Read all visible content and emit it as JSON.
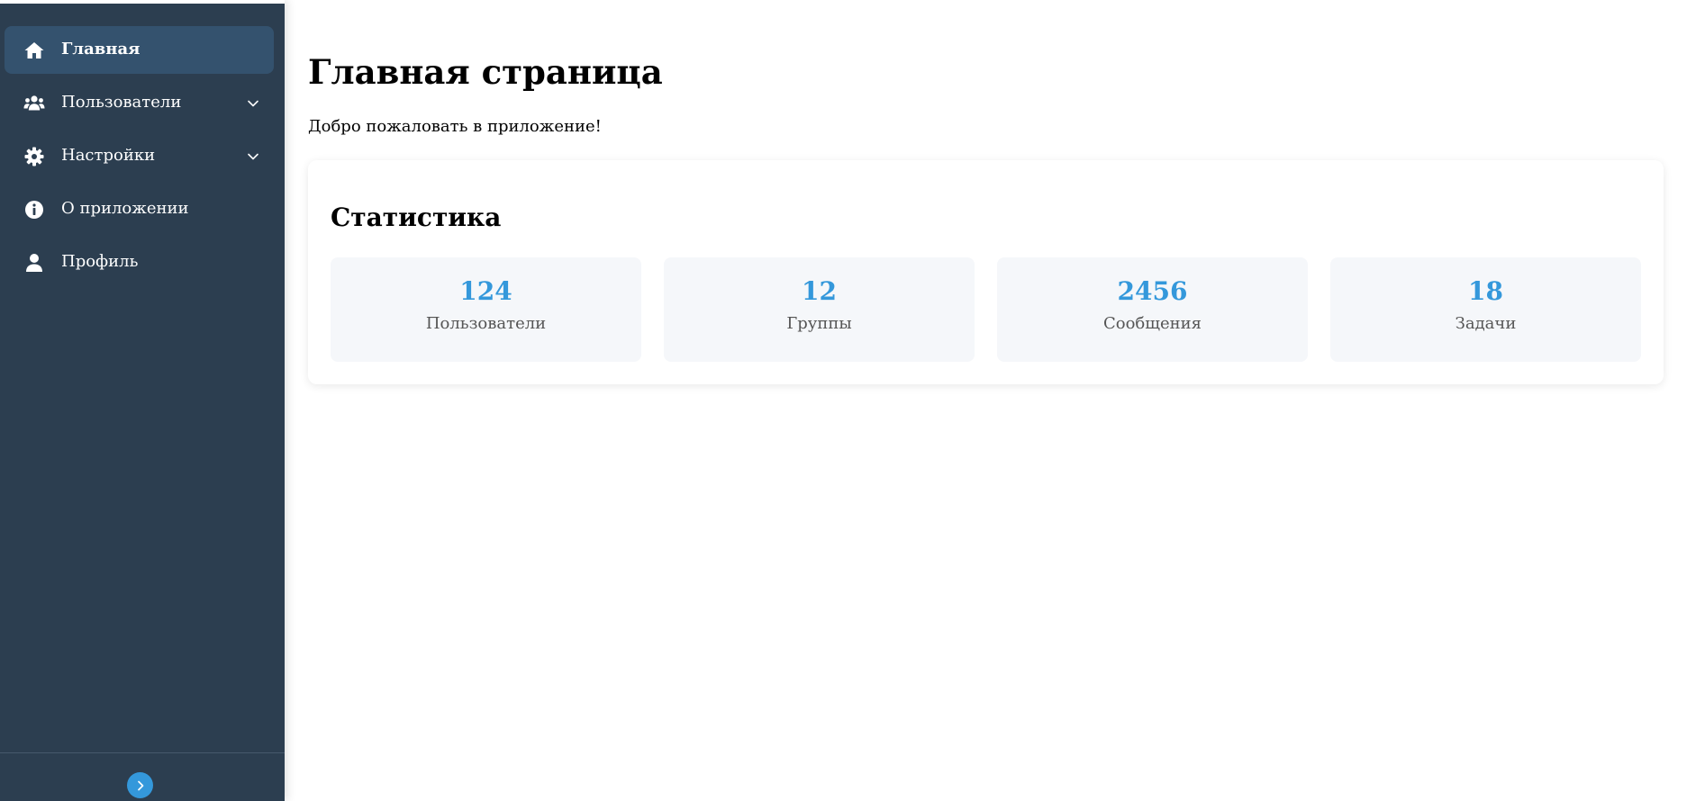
{
  "sidebar": {
    "items": [
      {
        "label": "Главная",
        "icon": "home-icon",
        "active": true,
        "expandable": false
      },
      {
        "label": "Пользователи",
        "icon": "users-icon",
        "active": false,
        "expandable": true
      },
      {
        "label": "Настройки",
        "icon": "gear-icon",
        "active": false,
        "expandable": true
      },
      {
        "label": "О приложении",
        "icon": "info-icon",
        "active": false,
        "expandable": false
      },
      {
        "label": "Профиль",
        "icon": "user-icon",
        "active": false,
        "expandable": false
      }
    ],
    "toggle_icon": "chevron-right-icon"
  },
  "main": {
    "title": "Главная страница",
    "welcome": "Добро пожаловать в приложение!",
    "stats": {
      "title": "Статистика",
      "items": [
        {
          "value": "124",
          "label": "Пользователи"
        },
        {
          "value": "12",
          "label": "Группы"
        },
        {
          "value": "2456",
          "label": "Сообщения"
        },
        {
          "value": "18",
          "label": "Задачи"
        }
      ]
    }
  },
  "colors": {
    "sidebar_bg": "#2c3e50",
    "active_item_bg": "#34526e",
    "accent": "#3498db",
    "stat_box_bg": "#f5f7fa"
  }
}
